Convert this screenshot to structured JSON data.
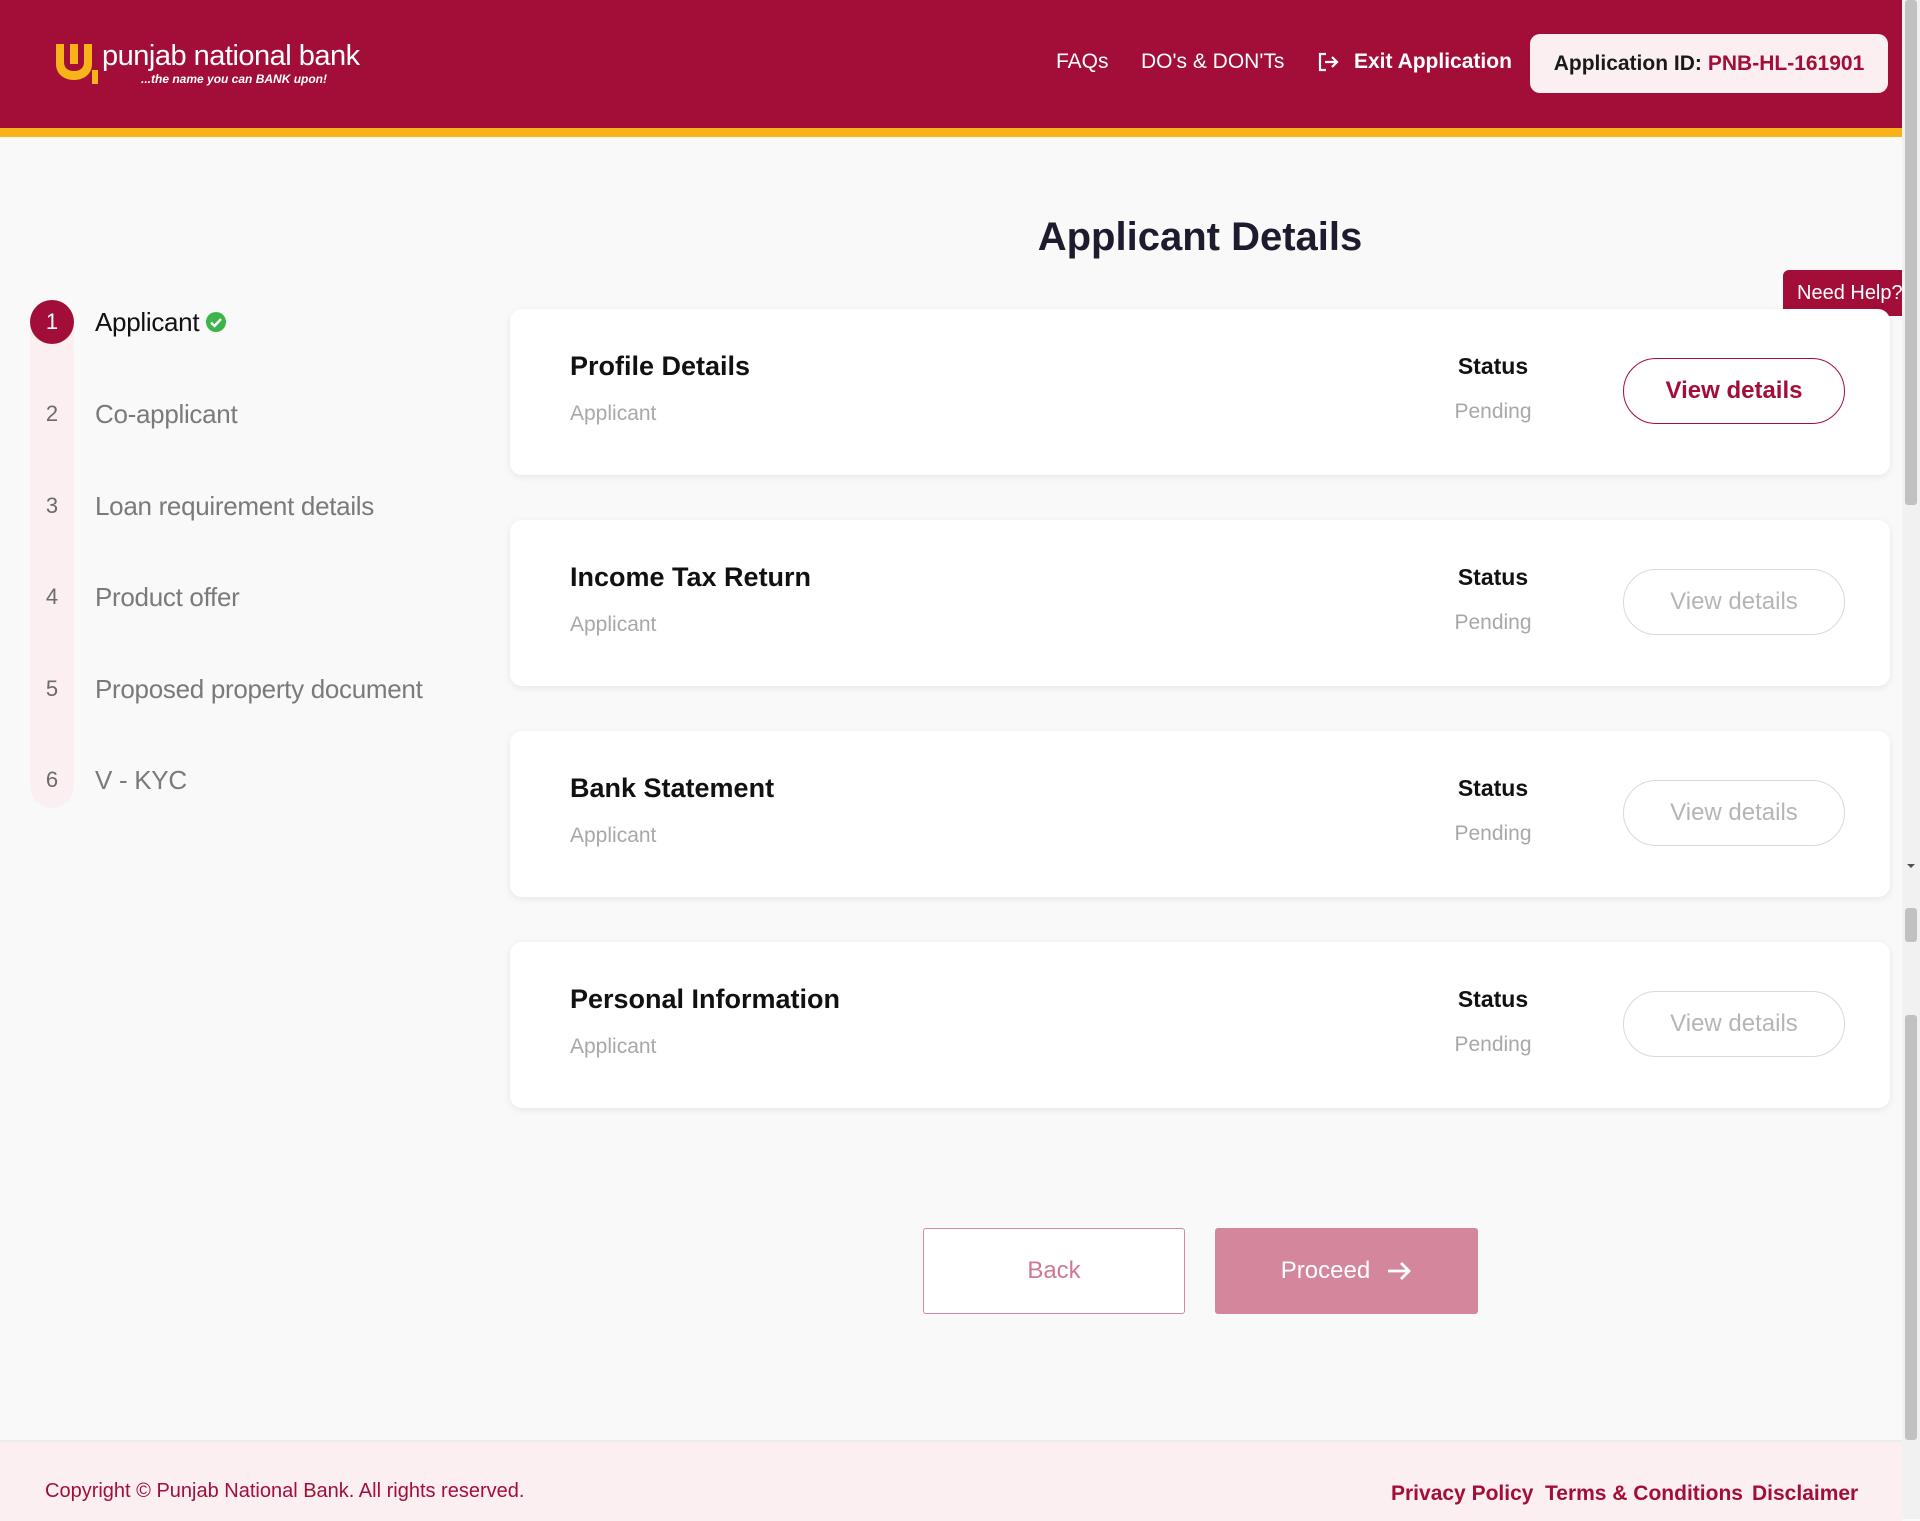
{
  "header": {
    "logo_name": "punjab national bank",
    "logo_tagline": "...the name you can BANK upon!",
    "nav": {
      "faqs": "FAQs",
      "dos_donts": "DO's & DON'Ts",
      "exit": "Exit Application"
    },
    "application_id_label": "Application ID:",
    "application_id_value": "PNB-HL-161901"
  },
  "page_title": "Applicant Details",
  "need_help": "Need Help?",
  "steps": [
    {
      "number": "1",
      "label": "Applicant",
      "active": true,
      "completed": true
    },
    {
      "number": "2",
      "label": "Co-applicant",
      "active": false,
      "completed": false
    },
    {
      "number": "3",
      "label": "Loan requirement details",
      "active": false,
      "completed": false
    },
    {
      "number": "4",
      "label": "Product offer",
      "active": false,
      "completed": false
    },
    {
      "number": "5",
      "label": "Proposed property document",
      "active": false,
      "completed": false
    },
    {
      "number": "6",
      "label": "V - KYC",
      "active": false,
      "completed": false
    }
  ],
  "cards": [
    {
      "title": "Profile Details",
      "subtitle": "Applicant",
      "status_label": "Status",
      "status_value": "Pending",
      "button": "View details",
      "button_enabled": true
    },
    {
      "title": "Income Tax Return",
      "subtitle": "Applicant",
      "status_label": "Status",
      "status_value": "Pending",
      "button": "View details",
      "button_enabled": false
    },
    {
      "title": "Bank Statement",
      "subtitle": "Applicant",
      "status_label": "Status",
      "status_value": "Pending",
      "button": "View details",
      "button_enabled": false
    },
    {
      "title": "Personal Information",
      "subtitle": "Applicant",
      "status_label": "Status",
      "status_value": "Pending",
      "button": "View details",
      "button_enabled": false
    }
  ],
  "actions": {
    "back": "Back",
    "proceed": "Proceed"
  },
  "footer": {
    "copyright": "Copyright © Punjab National Bank. All rights reserved.",
    "links": [
      "Privacy Policy",
      "Terms & Conditions",
      "Disclaimer"
    ]
  },
  "colors": {
    "brand_primary": "#a30e38",
    "brand_accent": "#f8b318",
    "success": "#3cb44a"
  },
  "icons": {
    "logo": "pnb-logo-icon",
    "exit": "exit-icon",
    "check": "check-circle-icon",
    "arrow": "arrow-right-icon"
  }
}
